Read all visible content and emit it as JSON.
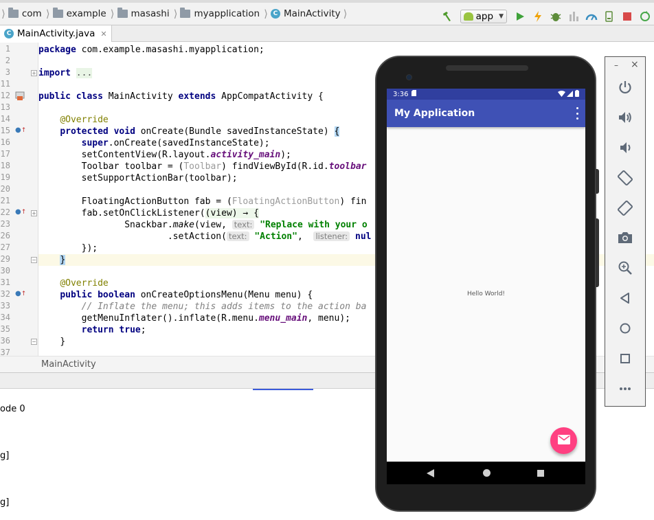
{
  "navbar": {
    "breadcrumbs": [
      {
        "label": "com",
        "icon": "folder-icon"
      },
      {
        "label": "example",
        "icon": "folder-icon"
      },
      {
        "label": "masashi",
        "icon": "folder-icon"
      },
      {
        "label": "myapplication",
        "icon": "folder-icon"
      },
      {
        "label": "MainActivity",
        "icon": "class-icon"
      }
    ],
    "run_config": "app"
  },
  "tab": {
    "label": "MainActivity.java"
  },
  "editor": {
    "line_numbers": [
      "1",
      "2",
      "3",
      "11",
      "12",
      "13",
      "14",
      "15",
      "16",
      "17",
      "18",
      "19",
      "20",
      "21",
      "22",
      "23",
      "26",
      "27",
      "28",
      "29",
      "30",
      "31",
      "32",
      "33",
      "34",
      "35",
      "36",
      "37"
    ],
    "line1": {
      "kw": "package",
      "rest": " com.example.masashi.myapplication;"
    },
    "line3": {
      "kw": "import",
      "folded": "..."
    },
    "line12": {
      "kw1": "public",
      "kw2": "class",
      "name": " MainActivity ",
      "kw3": "extends",
      "rest": " AppCompatActivity {"
    },
    "line14": {
      "annotation": "@Override"
    },
    "line15": {
      "kw1": "protected",
      "kw2": "void",
      "rest": " onCreate(Bundle savedInstanceState) ",
      "brace": "{"
    },
    "line16": {
      "kw": "super",
      "rest": ".onCreate(savedInstanceState);"
    },
    "line17": {
      "pre": "setContentView(R.layout.",
      "field": "activity_main",
      "post": ");"
    },
    "line18": {
      "pre": "Toolbar toolbar = (",
      "cast": "Toolbar",
      "mid": ") findViewById(R.id.",
      "field": "toolbar"
    },
    "line19": {
      "text": "setSupportActionBar(toolbar);"
    },
    "line21": {
      "pre": "FloatingActionButton fab = (",
      "cast": "FloatingActionButton",
      "post": ") fin"
    },
    "line22": {
      "pre": "fab.setOnClickListener(",
      "lambda": "(view) → {"
    },
    "line23": {
      "pre": "Snackbar.",
      "method": "make",
      "mid": "(view, ",
      "hint": "text:",
      "str": "\"Replace with your o"
    },
    "line26": {
      "pre": ".setAction(",
      "hint1": "text:",
      "str": "\"Action\"",
      "mid": ", ",
      "hint2": "listener:",
      "kw": "nul"
    },
    "line27": {
      "text": "});"
    },
    "line29": {
      "brace": "}"
    },
    "line31": {
      "annotation": "@Override"
    },
    "line32": {
      "kw1": "public",
      "kw2": "boolean",
      "rest": " onCreateOptionsMenu(Menu menu) {"
    },
    "line33": {
      "comment": "// Inflate the menu; this adds items to the action ba"
    },
    "line34": {
      "pre": "getMenuInflater().inflate(R.menu.",
      "field": "menu_main",
      "post": ", menu);"
    },
    "line35": {
      "kw1": "return",
      "kw2": "true",
      "post": ";"
    },
    "line36": {
      "text": "}"
    }
  },
  "code_breadcrumb": "MainActivity",
  "console": {
    "lines": [
      "ode 0",
      "g]",
      "g]"
    ]
  },
  "device": {
    "status_time": "3:36",
    "app_title": "My Application",
    "hello_text": "Hello World!",
    "colors": {
      "status_bar": "#303f9f",
      "app_bar": "#3f51b5",
      "fab": "#ff4081"
    }
  },
  "emulator_panel": {
    "minimize": "–",
    "close": "×",
    "buttons": [
      "power-icon",
      "volume-up-icon",
      "volume-down-icon",
      "rotate-left-icon",
      "rotate-right-icon",
      "camera-icon",
      "zoom-icon",
      "back-icon",
      "home-icon",
      "overview-icon",
      "more-icon"
    ]
  }
}
